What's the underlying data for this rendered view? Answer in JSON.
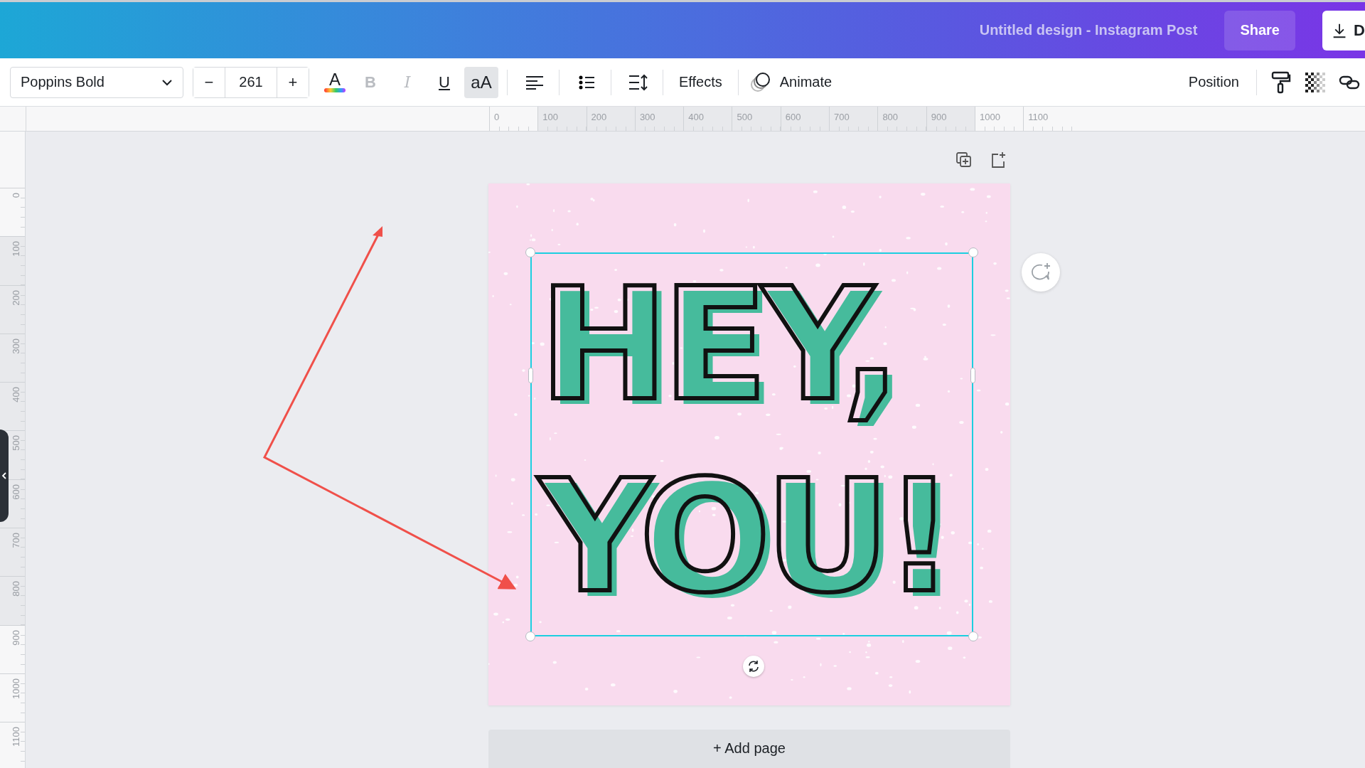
{
  "header": {
    "title": "Untitled design - Instagram Post",
    "share_label": "Share",
    "download_label": "D"
  },
  "toolbar": {
    "font": "Poppins Bold",
    "decrease": "−",
    "font_size": "261",
    "increase": "+",
    "text_color": "A",
    "text_styles": [
      {
        "kind": "bold",
        "label": "B",
        "disabled": true,
        "active": false
      },
      {
        "kind": "italic",
        "label": "I",
        "disabled": true,
        "active": false
      },
      {
        "kind": "underline",
        "label": "U",
        "disabled": false,
        "active": false
      },
      {
        "kind": "case",
        "label": "aA",
        "disabled": false,
        "active": true
      }
    ],
    "effects": "Effects",
    "animate": "Animate",
    "position": "Position"
  },
  "rulers": {
    "horizontal": [
      "0",
      "100",
      "200",
      "300",
      "400",
      "500",
      "600",
      "700",
      "800",
      "900",
      "1000",
      "1100"
    ],
    "vertical": [
      "0",
      "100",
      "200",
      "300",
      "400",
      "500",
      "600",
      "700",
      "800",
      "900",
      "1000",
      "1100"
    ]
  },
  "design": {
    "lines": [
      "HEY,",
      "YOU!"
    ]
  },
  "add_page": "+ Add page"
}
